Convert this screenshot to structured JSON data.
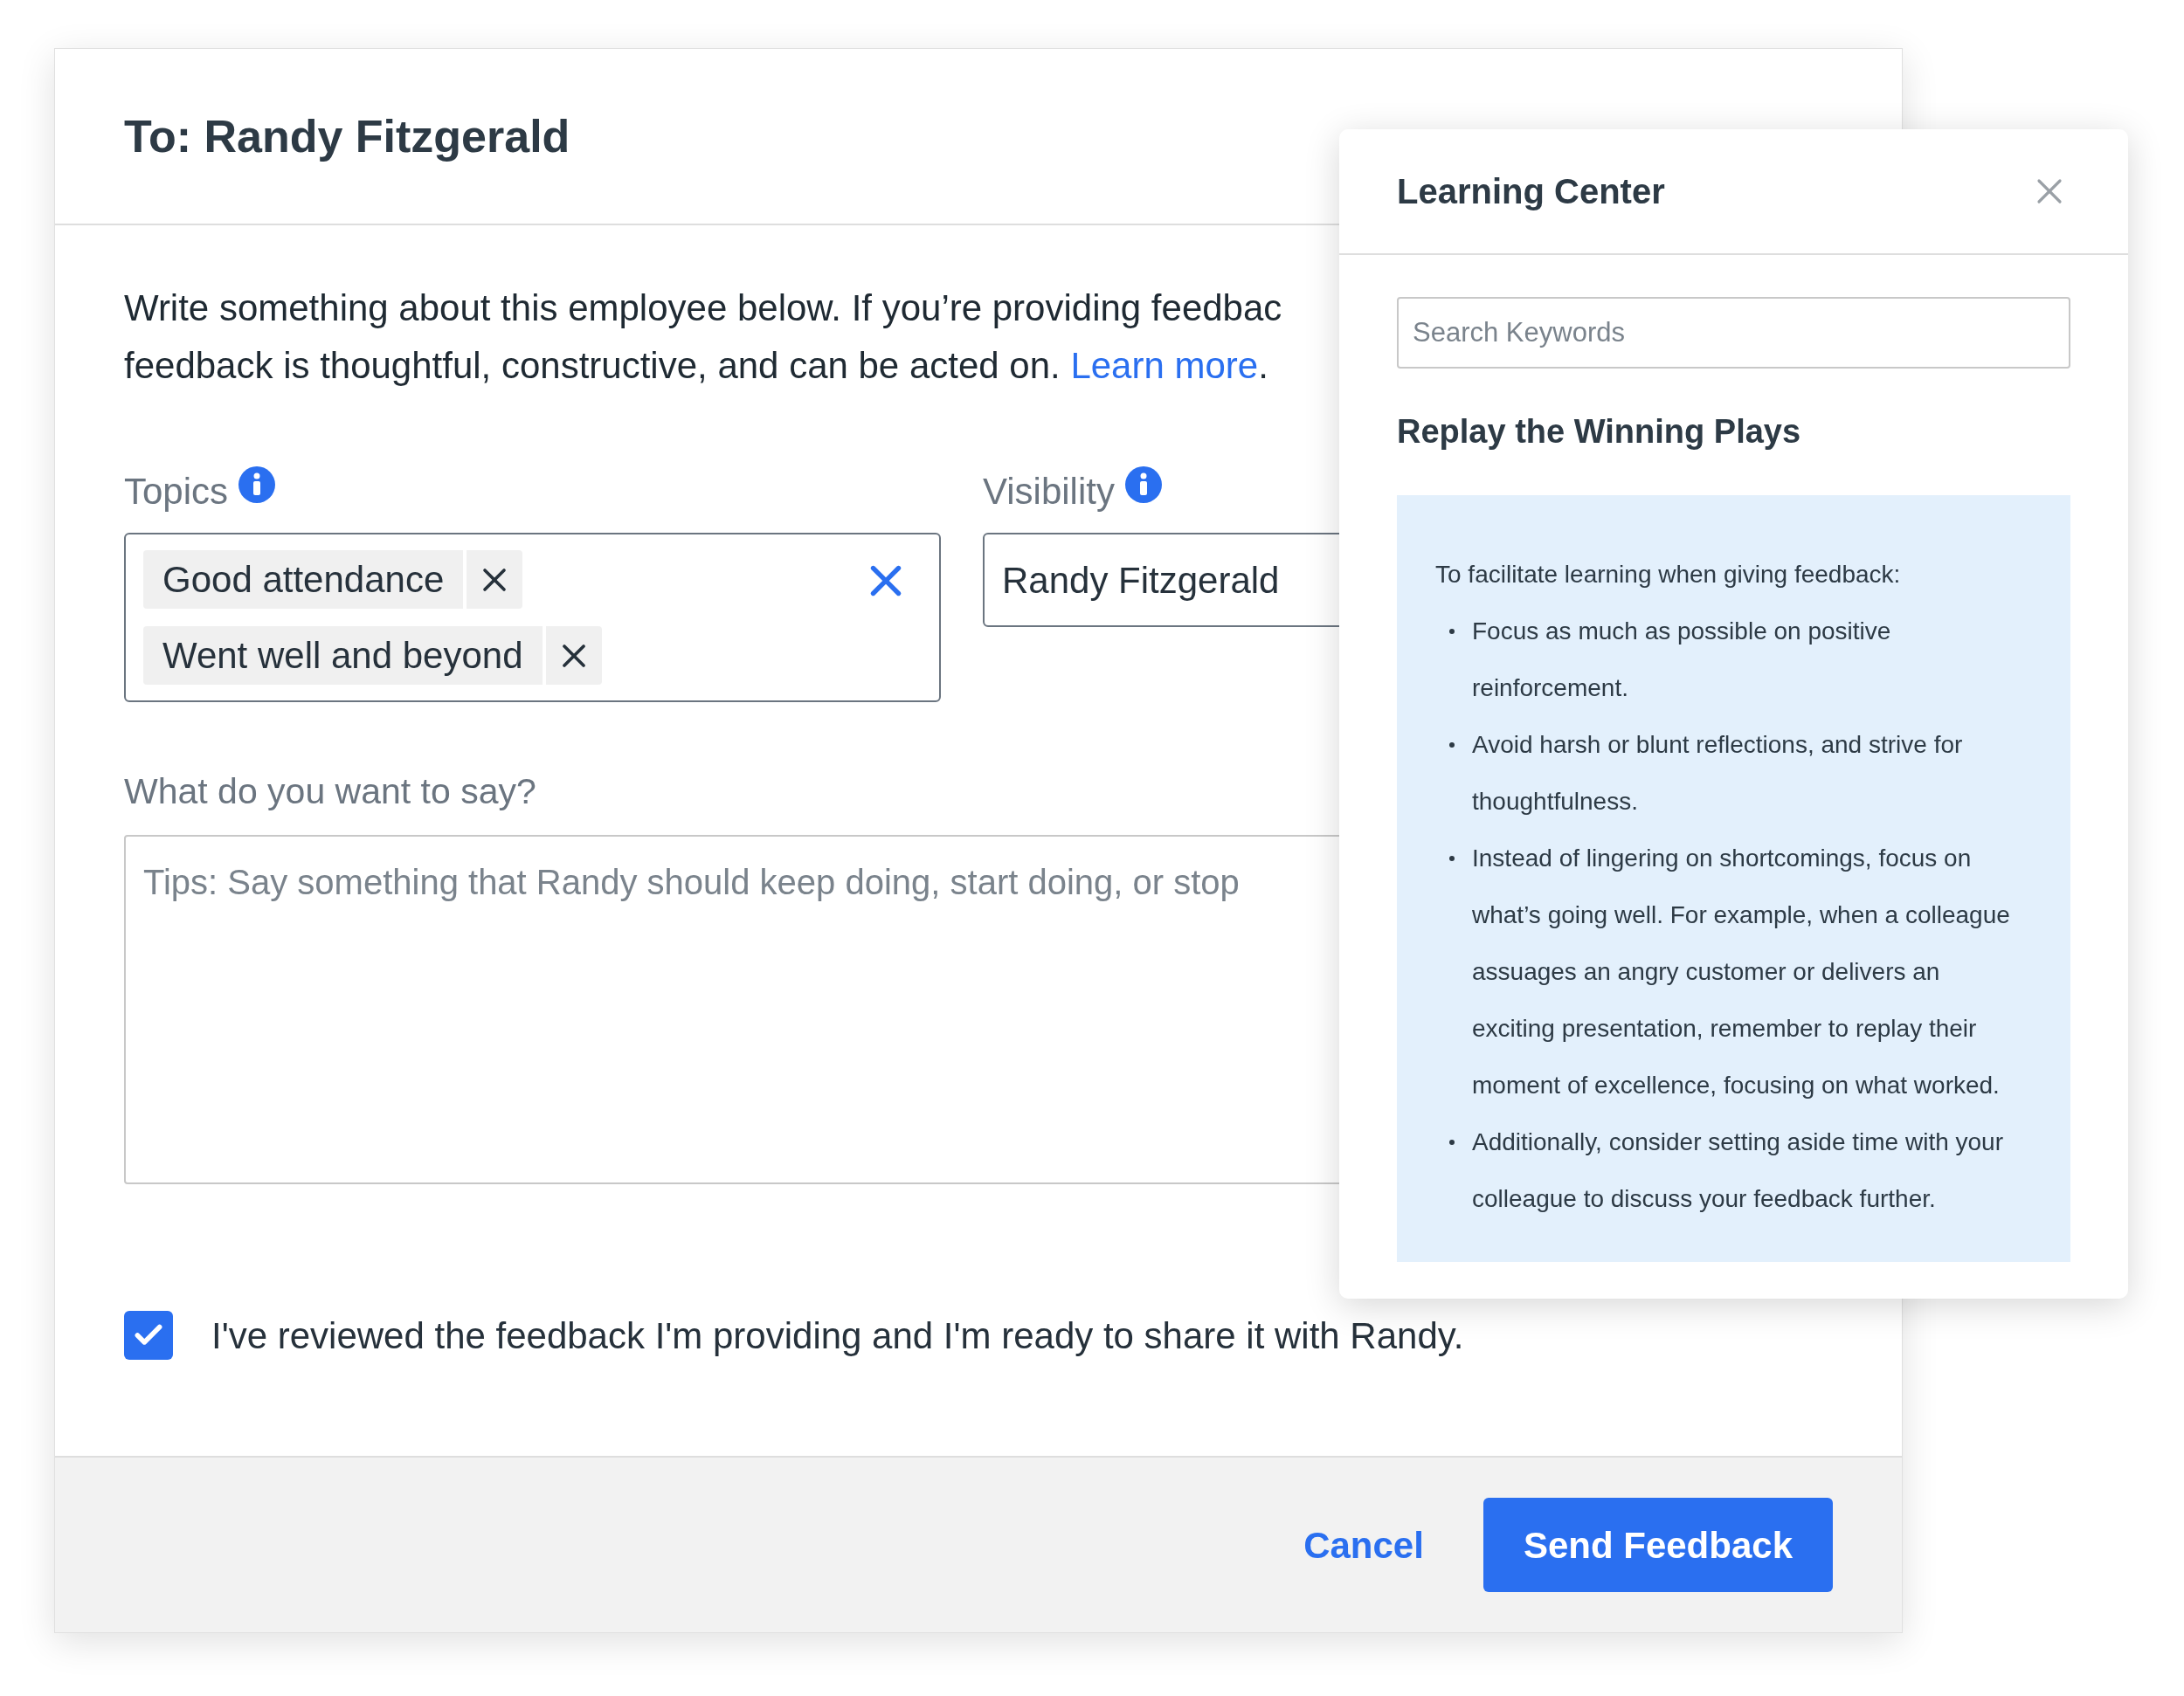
{
  "dialog": {
    "title": "To: Randy Fitzgerald",
    "intro": {
      "line_1": "Write something about this employee below. If you’re providing feedbac",
      "line_2": "feedback is thoughtful, constructive, and can be acted on.",
      "link": "Learn more",
      "end": "."
    },
    "topics": {
      "label": "Topics",
      "tags": [
        {
          "label": "Good attendance"
        },
        {
          "label": "Went well and beyond"
        }
      ]
    },
    "visibility": {
      "label": "Visibility",
      "value": "Randy Fitzgerald"
    },
    "message": {
      "label": "What do you want to say?",
      "placeholder": "Tips: Say something that Randy should keep doing, start doing, or stop"
    },
    "confirm": {
      "label": "I've reviewed the feedback I'm providing and I'm ready to share it with Randy.",
      "checked": true
    },
    "buttons": {
      "cancel": "Cancel",
      "send": "Send Feedback"
    }
  },
  "learning_center": {
    "title": "Learning Center",
    "search": {
      "placeholder": "Search Keywords"
    },
    "heading": "Replay the Winning Plays",
    "intro": "To facilitate learning when giving feedback:",
    "tips": [
      "Focus as much as possible on positive reinforcement.",
      "Avoid harsh or blunt reflections, and strive for thoughtfulness.",
      "Instead of lingering on shortcomings, focus on what’s going well. For example, when a colleague assuages an angry customer or delivers an exciting presentation, remember to replay their moment of excellence, focusing on what worked.",
      "Additionally, consider setting aside time with your colleague to discuss your feedback further."
    ]
  }
}
